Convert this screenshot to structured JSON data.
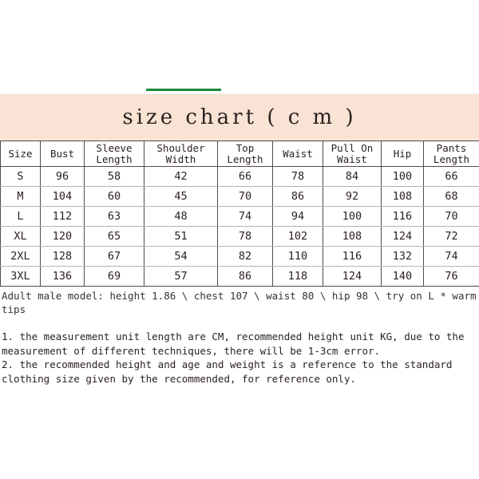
{
  "accent": {
    "green": "#1a8a3c",
    "band_background": "#f9e3d5"
  },
  "header": {
    "title": "size chart ( c m )"
  },
  "table": {
    "columns": [
      "Size",
      "Sleeve\nLength",
      "Bust",
      "Shoulder\nWidth",
      "Top\nLength",
      "Waist",
      "Pull On\nWaist",
      "Hip",
      "Pants\nLength"
    ],
    "headers": {
      "size": "Size",
      "bust": "Bust",
      "sleeve_length_1": "Sleeve",
      "sleeve_length_2": "Length",
      "shoulder_width_1": "Shoulder",
      "shoulder_width_2": "Width",
      "top_length_1": "Top",
      "top_length_2": "Length",
      "waist": "Waist",
      "pull_on_waist_1": "Pull On",
      "pull_on_waist_2": "Waist",
      "hip": "Hip",
      "pants_length_1": "Pants",
      "pants_length_2": "Length"
    },
    "rows": [
      {
        "size": "S",
        "bust": "96",
        "sleeve_length": "58",
        "shoulder_width": "42",
        "top_length": "66",
        "waist": "78",
        "pull_on_waist": "84",
        "hip": "100",
        "pants_length": "66"
      },
      {
        "size": "M",
        "bust": "104",
        "sleeve_length": "60",
        "shoulder_width": "45",
        "top_length": "70",
        "waist": "86",
        "pull_on_waist": "92",
        "hip": "108",
        "pants_length": "68"
      },
      {
        "size": "L",
        "bust": "112",
        "sleeve_length": "63",
        "shoulder_width": "48",
        "top_length": "74",
        "waist": "94",
        "pull_on_waist": "100",
        "hip": "116",
        "pants_length": "70"
      },
      {
        "size": "XL",
        "bust": "120",
        "sleeve_length": "65",
        "shoulder_width": "51",
        "top_length": "78",
        "waist": "102",
        "pull_on_waist": "108",
        "hip": "124",
        "pants_length": "72"
      },
      {
        "size": "2XL",
        "bust": "128",
        "sleeve_length": "67",
        "shoulder_width": "54",
        "top_length": "82",
        "waist": "110",
        "pull_on_waist": "116",
        "hip": "132",
        "pants_length": "74"
      },
      {
        "size": "3XL",
        "bust": "136",
        "sleeve_length": "69",
        "shoulder_width": "57",
        "top_length": "86",
        "waist": "118",
        "pull_on_waist": "124",
        "hip": "140",
        "pants_length": "76"
      }
    ]
  },
  "notes": {
    "model": "Adult male model: height 1.86 \\ chest 107 \\ waist 80 \\ hip 98 \\ try on L * warm tips",
    "item_1": "1. the measurement unit length are CM, recommended height unit KG, due to the measurement of different techniques, there will be 1-3cm error.",
    "item_2": "2. the recommended height and age and weight is a reference to the standard clothing size given by the recommended, for reference only."
  }
}
